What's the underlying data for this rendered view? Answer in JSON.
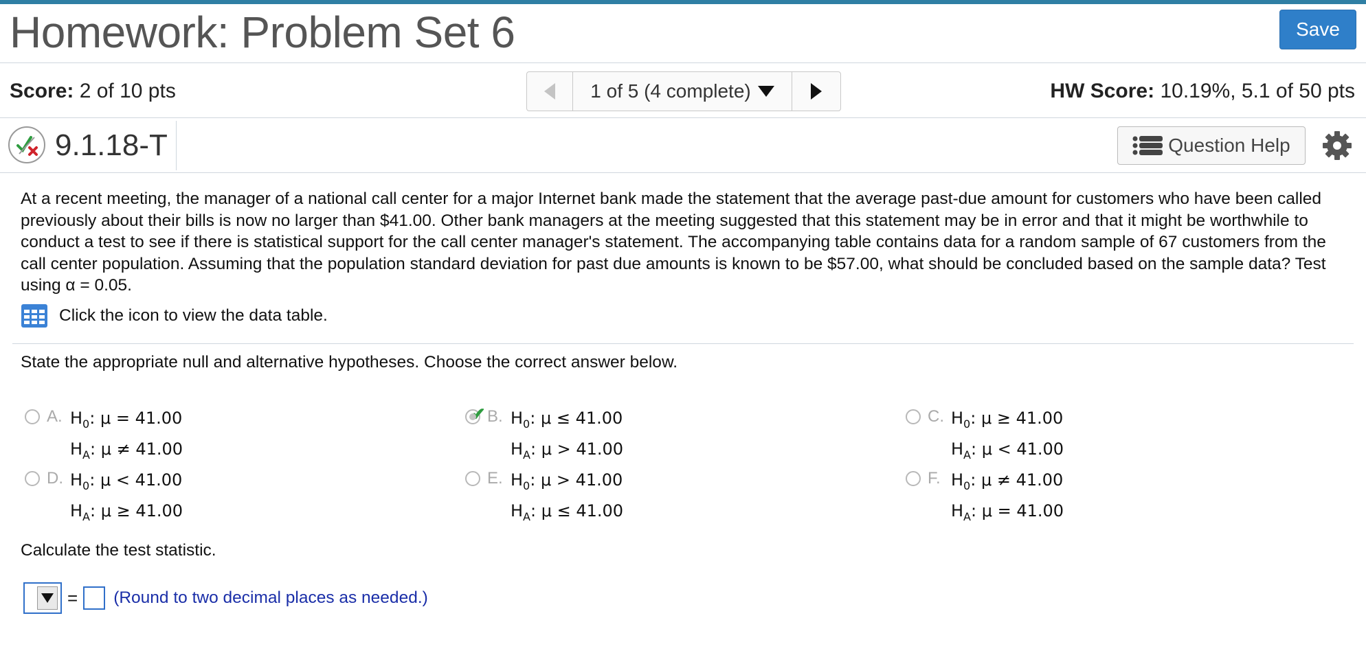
{
  "header": {
    "title": "Homework: Problem Set 6",
    "save_label": "Save"
  },
  "score_bar": {
    "score_label": "Score:",
    "score_value": "2 of 10 pts",
    "nav_position": "1 of 5 (4 complete)",
    "hw_score_label": "HW Score:",
    "hw_score_value": "10.19%, 5.1 of 50 pts"
  },
  "question": {
    "id": "9.1.18-T",
    "help_label": "Question Help",
    "status_icon": "partial-correct-icon",
    "problem_text": "At a recent meeting, the manager of a national call center for a major Internet bank made the statement that the average past-due amount for customers who have been called previously about their bills is now no larger than $41.00. Other bank managers at the meeting suggested that this statement may be in error and that it might be worthwhile to conduct a test to see if there is statistical support for the call center manager's statement. The accompanying table contains data for a random sample of 67 customers from the call center population. Assuming that the population standard deviation for past due amounts is known to be $57.00, what should be concluded based on the sample data? Test using α = 0.05.",
    "data_table_link": "Click the icon to view the data table.",
    "instruction": "State the appropriate null and alternative hypotheses. Choose the correct answer below.",
    "options": [
      {
        "letter": "A.",
        "h0_rel": ": μ = 41.00",
        "ha_rel": ": μ ≠ 41.00",
        "selected": false
      },
      {
        "letter": "B.",
        "h0_rel": ": μ ≤ 41.00",
        "ha_rel": ": μ > 41.00",
        "selected": true
      },
      {
        "letter": "C.",
        "h0_rel": ": μ ≥ 41.00",
        "ha_rel": ": μ < 41.00",
        "selected": false
      },
      {
        "letter": "D.",
        "h0_rel": ": μ < 41.00",
        "ha_rel": ": μ ≥ 41.00",
        "selected": false
      },
      {
        "letter": "E.",
        "h0_rel": ": μ > 41.00",
        "ha_rel": ": μ ≤ 41.00",
        "selected": false
      },
      {
        "letter": "F.",
        "h0_rel": ": μ ≠ 41.00",
        "ha_rel": ": μ = 41.00",
        "selected": false
      }
    ],
    "h0_prefix": "H",
    "h0_sub": "0",
    "ha_prefix": "H",
    "ha_sub": "A",
    "calc_label": "Calculate the test statistic.",
    "equals": "=",
    "round_note": "(Round to two decimal places as needed.)"
  },
  "colors": {
    "accent": "#2f7fc9",
    "topbar": "#2f7fa4",
    "check_green": "#2e9c3f",
    "note_blue": "#1a2ea8"
  }
}
